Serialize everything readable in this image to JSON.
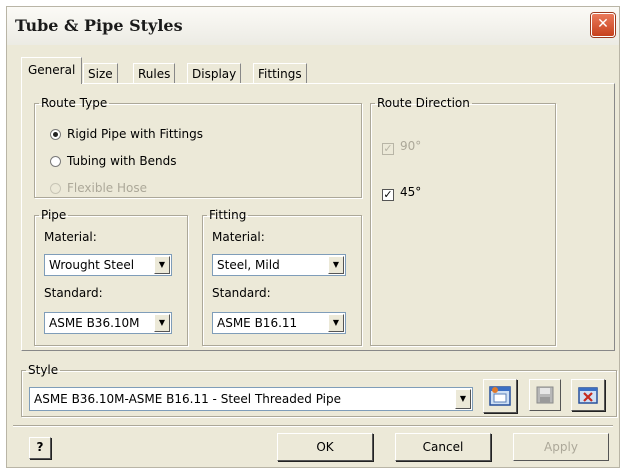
{
  "window": {
    "title": "Tube & Pipe Styles",
    "close_glyph": "✕"
  },
  "tabs": [
    {
      "label": "General",
      "active": true
    },
    {
      "label": "Size"
    },
    {
      "label": "Rules"
    },
    {
      "label": "Display"
    },
    {
      "label": "Fittings"
    }
  ],
  "route_type": {
    "legend": "Route Type",
    "options": [
      {
        "label": "Rigid Pipe with Fittings",
        "selected": true,
        "enabled": true
      },
      {
        "label": "Tubing with Bends",
        "selected": false,
        "enabled": true
      },
      {
        "label": "Flexible Hose",
        "selected": false,
        "enabled": false
      }
    ]
  },
  "route_direction": {
    "legend": "Route Direction",
    "options": [
      {
        "label": "90°",
        "checked": true,
        "enabled": false
      },
      {
        "label": "45°",
        "checked": true,
        "enabled": true
      }
    ]
  },
  "pipe": {
    "legend": "Pipe",
    "material_label": "Material:",
    "material_value": "Wrought Steel",
    "standard_label": "Standard:",
    "standard_value": "ASME B36.10M"
  },
  "fitting": {
    "legend": "Fitting",
    "material_label": "Material:",
    "material_value": "Steel, Mild",
    "standard_label": "Standard:",
    "standard_value": "ASME B16.11"
  },
  "style": {
    "legend": "Style",
    "selected": "ASME B36.10M-ASME B16.11 - Steel Threaded Pipe",
    "icons": [
      "style-edit-icon",
      "save-icon",
      "delete-icon"
    ]
  },
  "footer": {
    "help_glyph": "?",
    "ok": "OK",
    "cancel": "Cancel",
    "apply": "Apply"
  },
  "colors": {
    "dialog_bg": "#ece9d8",
    "close_red": "#c6411d",
    "disabled_text": "#aca899"
  }
}
